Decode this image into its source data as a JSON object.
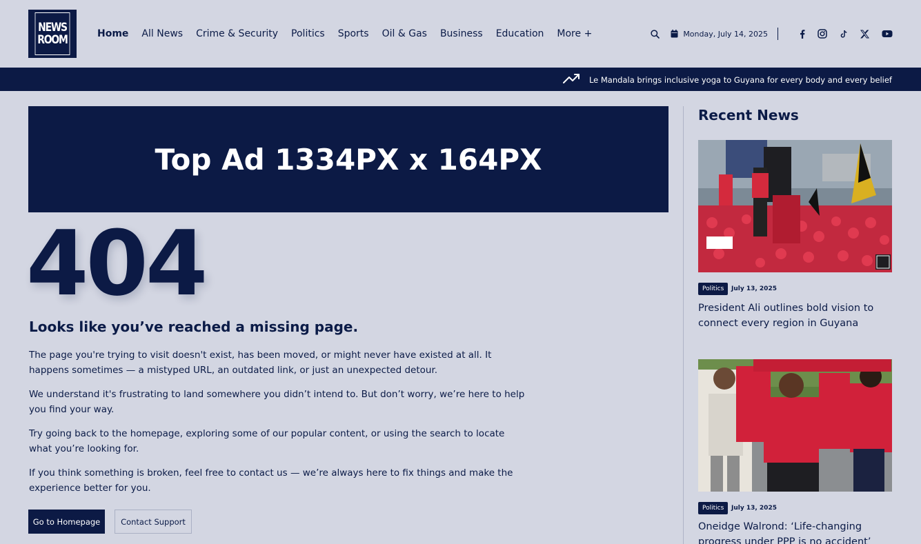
{
  "brand": {
    "logo_line1": "NEWS",
    "logo_line2": "ROOM"
  },
  "nav": [
    {
      "label": "Home",
      "active": true
    },
    {
      "label": "All News"
    },
    {
      "label": "Crime & Security"
    },
    {
      "label": "Politics"
    },
    {
      "label": "Sports"
    },
    {
      "label": "Oil & Gas"
    },
    {
      "label": "Business"
    },
    {
      "label": "Education"
    },
    {
      "label": "More +"
    }
  ],
  "header": {
    "date": "Monday, July 14, 2025",
    "icons": [
      "search-icon",
      "calendar-icon",
      "facebook-icon",
      "instagram-icon",
      "tiktok-icon",
      "x-icon",
      "youtube-icon"
    ]
  },
  "ticker": {
    "text": "Le Mandala brings inclusive yoga to Guyana for every body and every belief",
    "icon": "trending-up-icon"
  },
  "ad": {
    "text": "Top Ad 1334PX x 164PX"
  },
  "error": {
    "code": "404",
    "title": "Looks like you’ve reached a missing page.",
    "paragraphs": [
      "The page you're trying to visit doesn't exist, has been moved, or might never have existed at all. It happens sometimes — a mistyped URL, an outdated link, or just an unexpected detour.",
      "We understand it's frustrating to land somewhere you didn’t intend to. But don’t worry, we’re here to help you find your way.",
      "Try going back to the homepage, exploring some of our popular content, or using the search to locate what you’re looking for.",
      "If you think something is broken, feel free to contact us — we’re always here to fix things and make the experience better for you."
    ],
    "home_button": "Go to Homepage",
    "support_button": "Contact Support"
  },
  "sidebar": {
    "title": "Recent News",
    "items": [
      {
        "category": "Politics",
        "date": "July 13, 2025",
        "headline": "President Ali outlines bold vision to connect every region in Guyana"
      },
      {
        "category": "Politics",
        "date": "July 13, 2025",
        "headline": "Oneidge Walrond: ‘Life-changing progress under PPP is no accident’"
      }
    ]
  },
  "colors": {
    "navy": "#0c1a45",
    "background": "#d3d6e2",
    "crowd_red": "#d1213a"
  }
}
